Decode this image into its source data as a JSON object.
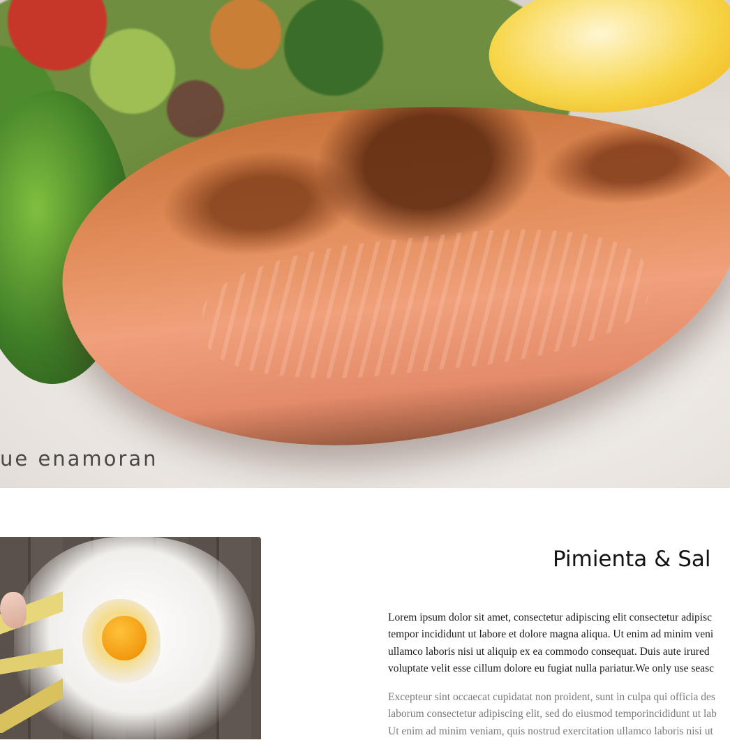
{
  "hero": {
    "tagline": "ue enamoran"
  },
  "about": {
    "title": "Pimienta & Sal",
    "paragraph_1": [
      "Lorem ipsum dolor sit amet, consectetur adipiscing elit consectetur adipisc",
      "tempor incididunt ut labore et dolore magna aliqua. Ut enim ad minim veni",
      "ullamco laboris nisi ut aliquip ex ea commodo consequat. Duis aute irured",
      "voluptate velit esse cillum dolore eu fugiat nulla pariatur.We only use seasc"
    ],
    "paragraph_2": [
      "Excepteur sint occaecat cupidatat non proident, sunt in culpa qui officia des",
      "laborum consectetur adipiscing elit, sed do eiusmod temporincididunt ut lab",
      "Ut enim ad minim veniam, quis nostrud exercitation ullamco laboris nisi ut"
    ]
  }
}
